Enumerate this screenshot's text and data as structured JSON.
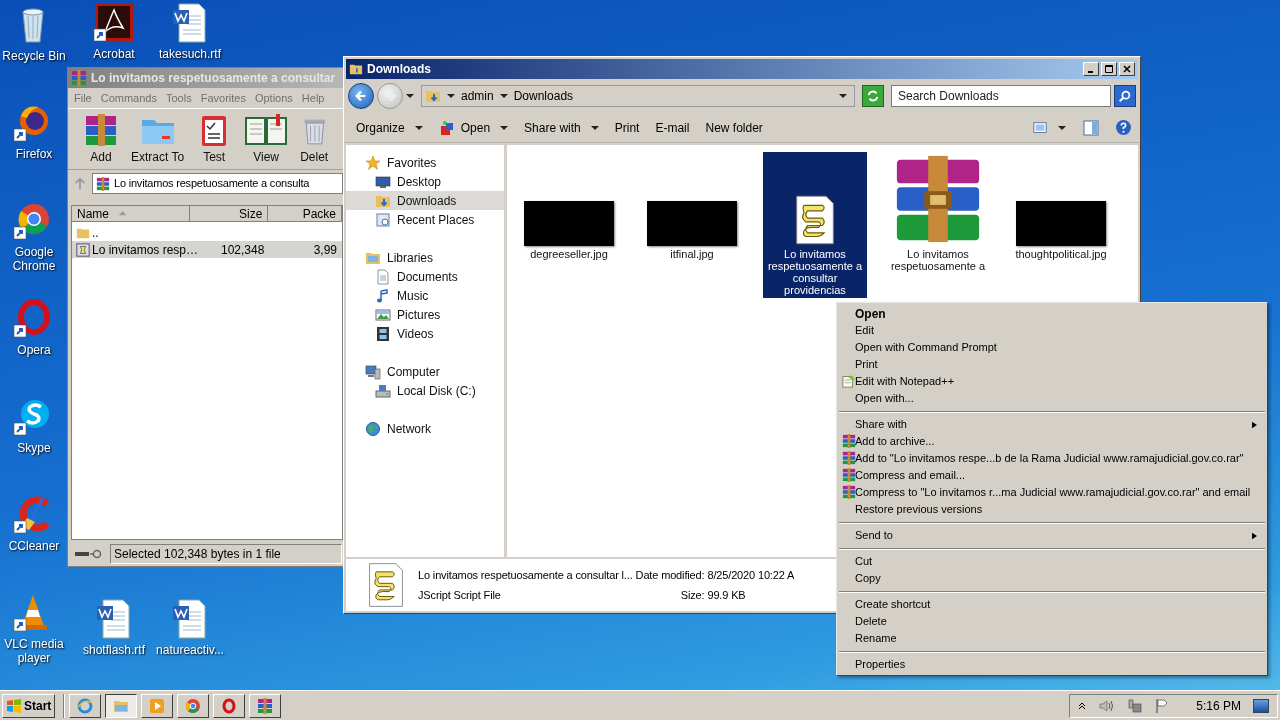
{
  "desktop": {
    "left_column": [
      {
        "label": "Recycle Bin",
        "kind": "recycle",
        "shortcut": false
      },
      {
        "label": "Firefox",
        "kind": "firefox",
        "shortcut": true
      },
      {
        "label": "Google Chrome",
        "kind": "chrome",
        "shortcut": true
      },
      {
        "label": "Opera",
        "kind": "opera",
        "shortcut": true
      },
      {
        "label": "Skype",
        "kind": "skype",
        "shortcut": true
      },
      {
        "label": "CCleaner",
        "kind": "ccleaner",
        "shortcut": true
      },
      {
        "label": "VLC media player",
        "kind": "vlc",
        "shortcut": true
      }
    ],
    "top_row": [
      {
        "label": "Acrobat",
        "kind": "acrobat",
        "shortcut": true
      },
      {
        "label": "takesuch.rtf",
        "kind": "word",
        "shortcut": false
      }
    ],
    "bottom_row": [
      {
        "label": "shotflash.rtf",
        "kind": "word",
        "shortcut": false
      },
      {
        "label": "natureactiv...",
        "kind": "word",
        "shortcut": false
      }
    ]
  },
  "archiver": {
    "title": "Lo invitamos respetuosamente a consultar",
    "menu": [
      "File",
      "Commands",
      "Tools",
      "Favorites",
      "Options",
      "Help"
    ],
    "toolbar": [
      {
        "label": "Add",
        "kind": "add"
      },
      {
        "label": "Extract To",
        "kind": "extract"
      },
      {
        "label": "Test",
        "kind": "test"
      },
      {
        "label": "View",
        "kind": "view"
      },
      {
        "label": "Delet",
        "kind": "delete"
      }
    ],
    "path": "Lo invitamos respetuosamente a consulta",
    "columns": [
      "Name",
      "Size",
      "Packe"
    ],
    "rows": [
      {
        "kind": "parent",
        "name": "..",
        "size": "",
        "packed": "",
        "selected": false
      },
      {
        "kind": "script",
        "name": "Lo invitamos resp…",
        "size": "102,348",
        "packed": "3,99",
        "selected": true
      }
    ],
    "status": "Selected 102,348 bytes in 1 file"
  },
  "explorer": {
    "title": "Downloads",
    "breadcrumb": [
      "admin",
      "Downloads"
    ],
    "search": {
      "placeholder": "Search Downloads"
    },
    "commands": [
      {
        "label": "Organize",
        "kind": "menu"
      },
      {
        "label": "Open",
        "kind": "open"
      },
      {
        "label": "Share with",
        "kind": "menu"
      },
      {
        "label": "Print",
        "kind": "plain"
      },
      {
        "label": "E-mail",
        "kind": "plain"
      },
      {
        "label": "New folder",
        "kind": "plain"
      }
    ],
    "nav_pane": [
      {
        "label": "Favorites",
        "kind": "favorites",
        "selected": false,
        "children": [
          {
            "label": "Desktop",
            "kind": "desktop",
            "selected": false
          },
          {
            "label": "Downloads",
            "kind": "downloads",
            "selected": true
          },
          {
            "label": "Recent Places",
            "kind": "recent",
            "selected": false
          }
        ]
      },
      {
        "label": "Libraries",
        "kind": "libraries",
        "selected": false,
        "children": [
          {
            "label": "Documents",
            "kind": "documents",
            "selected": false
          },
          {
            "label": "Music",
            "kind": "music",
            "selected": false
          },
          {
            "label": "Pictures",
            "kind": "pictures",
            "selected": false
          },
          {
            "label": "Videos",
            "kind": "videos",
            "selected": false
          }
        ]
      },
      {
        "label": "Computer",
        "kind": "computer",
        "selected": false,
        "children": [
          {
            "label": "Local Disk (C:)",
            "kind": "disk",
            "selected": false
          }
        ]
      },
      {
        "label": "Network",
        "kind": "network",
        "selected": false
      }
    ],
    "files": [
      {
        "name": "degreeseller.jpg",
        "kind": "image",
        "selected": false
      },
      {
        "name": "itfinal.jpg",
        "kind": "image",
        "selected": false
      },
      {
        "name": "Lo invitamos respetuosamente a consultar providencias",
        "kind": "script",
        "selected": true
      },
      {
        "name": "Lo invitamos respetuosamente a",
        "kind": "archive",
        "selected": false
      },
      {
        "name": "thoughtpolitical.jpg",
        "kind": "image",
        "selected": false
      }
    ],
    "details": {
      "name": "Lo invitamos respetuosamente a consultar l...",
      "type": "JScript Script File",
      "date_label": "Date modified:",
      "date": "8/25/2020 10:22 A",
      "size_label": "Size:",
      "size": "99.9 KB"
    }
  },
  "context_menu": [
    [
      {
        "label": "Open",
        "kind": "default"
      },
      {
        "label": "Edit",
        "kind": "plain"
      },
      {
        "label": "Open with Command Prompt",
        "kind": "plain"
      },
      {
        "label": "Print",
        "kind": "plain"
      },
      {
        "label": "Edit with Notepad++",
        "kind": "notepad"
      },
      {
        "label": "Open with...",
        "kind": "plain"
      }
    ],
    [
      {
        "label": "Share with",
        "kind": "submenu"
      },
      {
        "label": "Add to archive...",
        "kind": "archiver"
      },
      {
        "label": "Add to \"Lo invitamos respe...b de la Rama Judicial www.ramajudicial.gov.co.rar\"",
        "kind": "archiver"
      },
      {
        "label": "Compress and email...",
        "kind": "archiver"
      },
      {
        "label": "Compress to \"Lo invitamos r...ma Judicial www.ramajudicial.gov.co.rar\" and email",
        "kind": "archiver"
      },
      {
        "label": "Restore previous versions",
        "kind": "plain"
      }
    ],
    [
      {
        "label": "Send to",
        "kind": "submenu"
      }
    ],
    [
      {
        "label": "Cut",
        "kind": "plain"
      },
      {
        "label": "Copy",
        "kind": "plain"
      }
    ],
    [
      {
        "label": "Create shortcut",
        "kind": "plain"
      },
      {
        "label": "Delete",
        "kind": "plain"
      },
      {
        "label": "Rename",
        "kind": "plain"
      }
    ],
    [
      {
        "label": "Properties",
        "kind": "plain"
      }
    ]
  ],
  "taskbar": {
    "start": "Start",
    "apps": [
      {
        "kind": "ie",
        "selected": false
      },
      {
        "kind": "explorer",
        "selected": true
      },
      {
        "kind": "media",
        "selected": false
      },
      {
        "kind": "chrome",
        "selected": false
      },
      {
        "kind": "opera",
        "selected": false
      },
      {
        "kind": "archiver",
        "selected": false
      }
    ],
    "clock": "5:16 PM"
  }
}
